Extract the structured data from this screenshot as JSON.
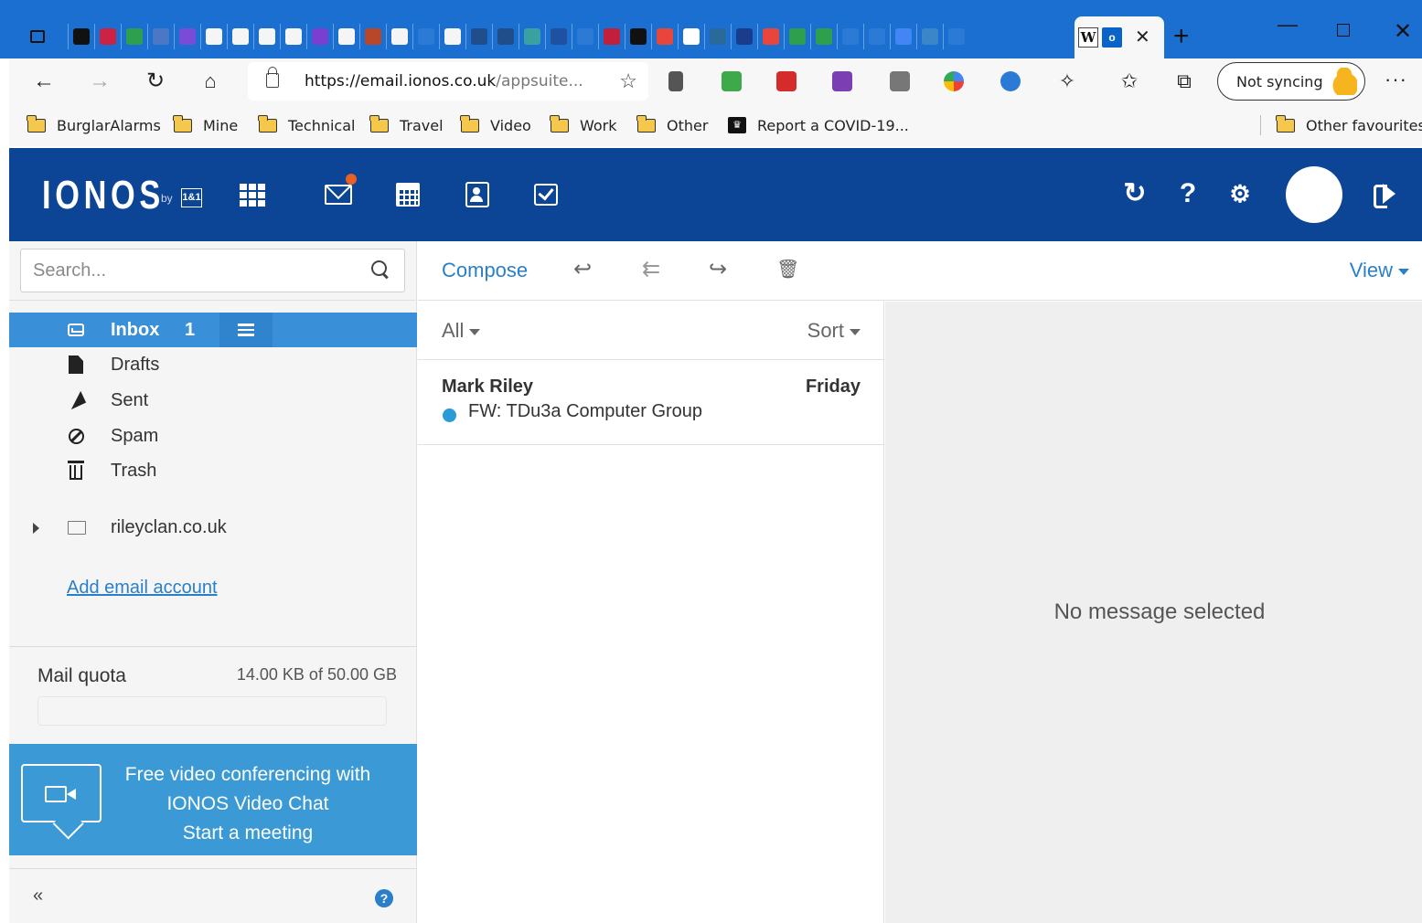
{
  "browser": {
    "url_host": "https://email.ionos.co.uk",
    "url_rest": "/appsuite...",
    "sync_label": "Not syncing",
    "tab_favicon_colors": [
      "#111111",
      "#cc2244",
      "#2e9f4c",
      "#4a78c4",
      "#7a4bd6",
      "#f5f5f5",
      "#f5f5f5",
      "#f5f5f5",
      "#f5f5f5",
      "#7a3fd0",
      "#f5f5f5",
      "#b8472a",
      "#f5f5f5",
      "#2b7ad6",
      "#f5f5f5",
      "#1f4e8a",
      "#1f4e8a",
      "#3aa0a0",
      "#2050a0",
      "#2b7ad6",
      "#c21f3a",
      "#111111",
      "#e8453c",
      "#ffffff",
      "#2a6a9a",
      "#1b3c8c",
      "#e8453c",
      "#2e9f4c",
      "#2e9f4c",
      "#2b7ad6",
      "#2b7ad6",
      "#4285f4",
      "#3a86c8",
      "#2b7ad6"
    ],
    "bookmarks": [
      {
        "label": "BurglarAlarms"
      },
      {
        "label": "Mine"
      },
      {
        "label": "Technical"
      },
      {
        "label": "Travel"
      },
      {
        "label": "Video"
      },
      {
        "label": "Work"
      },
      {
        "label": "Other"
      },
      {
        "label": "Report a COVID-19..."
      }
    ],
    "other_favourites": "Other favourites"
  },
  "app": {
    "logo_text": "IONOS",
    "logo_by": "by",
    "logo_brand": "1&1",
    "accent": "#0c4596",
    "selection": "#3a90d8"
  },
  "sidebar": {
    "search_placeholder": "Search...",
    "folders": [
      {
        "label": "Inbox",
        "count": "1",
        "icon": "inbox-icon"
      },
      {
        "label": "Drafts",
        "icon": "file-icon"
      },
      {
        "label": "Sent",
        "icon": "paper-plane-icon"
      },
      {
        "label": "Spam",
        "icon": "ban-icon"
      },
      {
        "label": "Trash",
        "icon": "trash-icon"
      }
    ],
    "account": "rileyclan.co.uk",
    "add_account": "Add email account",
    "quota_label": "Mail quota",
    "quota_value": "14.00 KB of 50.00 GB",
    "quota_fraction": 3e-07,
    "promo_line1": "Free video conferencing with",
    "promo_line2": "IONOS Video Chat",
    "promo_line3": "Start a meeting",
    "collapse": "«",
    "help": "?"
  },
  "toolbar": {
    "compose": "Compose",
    "view": "View"
  },
  "list": {
    "filter": "All",
    "sort": "Sort",
    "messages": [
      {
        "sender": "Mark Riley",
        "date": "Friday",
        "subject": "FW: TDu3a Computer Group",
        "unread": true
      }
    ]
  },
  "preview": {
    "empty_text": "No message selected"
  }
}
